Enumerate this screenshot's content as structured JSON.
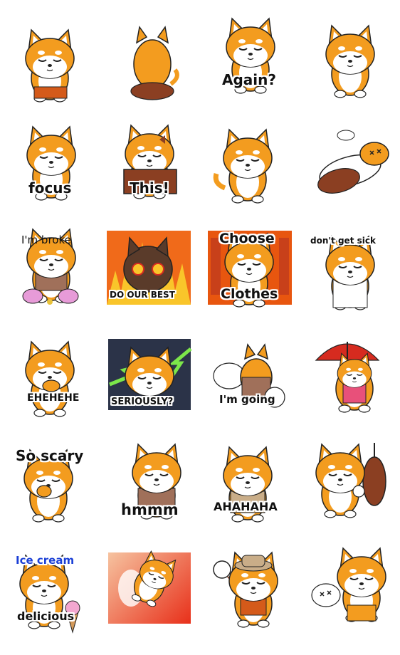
{
  "colors": {
    "fur": "#f39c1f",
    "fur_light": "#ffffff",
    "outline": "#222222",
    "red": "#d62b1f",
    "brown": "#8b3f22",
    "blue": "#1a3fd6"
  },
  "stickers": [
    {
      "caption": ""
    },
    {
      "caption": ""
    },
    {
      "caption": "Again?"
    },
    {
      "caption": ""
    },
    {
      "caption": "focus"
    },
    {
      "caption": "This!"
    },
    {
      "caption": ""
    },
    {
      "caption": ""
    },
    {
      "caption": "I'm broke"
    },
    {
      "caption": "DO OUR BEST"
    },
    {
      "caption_top": "Choose",
      "caption_bottom": "Clothes"
    },
    {
      "caption": "don't get sick"
    },
    {
      "caption": "EHEHEHE"
    },
    {
      "caption": "SERIOUSLY?"
    },
    {
      "caption": "I'm going"
    },
    {
      "caption": ""
    },
    {
      "caption": "So scary"
    },
    {
      "caption": "hmmm"
    },
    {
      "caption": "AHAHAHA"
    },
    {
      "caption": ""
    },
    {
      "caption_top": "Ice cream",
      "caption_bottom": "delicious"
    },
    {
      "caption": ""
    },
    {
      "caption": ""
    },
    {
      "caption": ""
    }
  ]
}
